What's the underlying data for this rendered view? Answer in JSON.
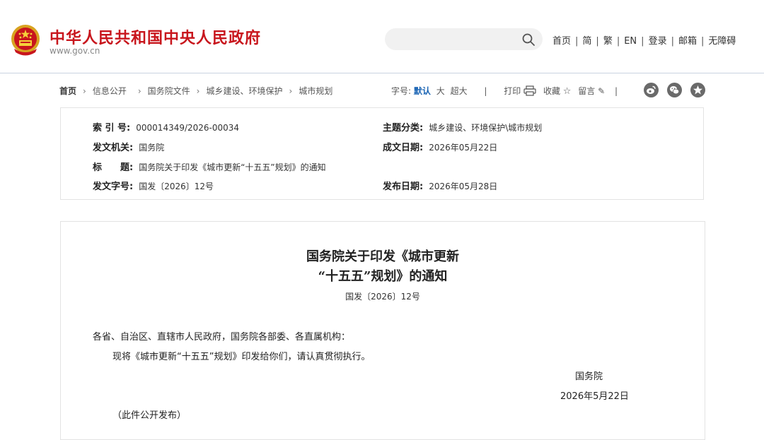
{
  "header": {
    "site_title": "中华人民共和国中央人民政府",
    "domain": "www.gov.cn",
    "search_placeholder": "",
    "nav": [
      "首页",
      "简",
      "繁",
      "EN",
      "登录",
      "邮箱",
      "无障碍"
    ],
    "brand_color": "#c8161d"
  },
  "breadcrumb": [
    "首页",
    "信息公开",
    "国务院文件",
    "城乡建设、环境保护",
    "城市规划"
  ],
  "tools": {
    "font_label": "字号:",
    "font_default": "默认",
    "font_large": "大",
    "font_xlarge": "超大",
    "print": "打印",
    "favorite": "收藏",
    "comment": "留言",
    "share_icons": [
      "weibo-icon",
      "wechat-icon",
      "qzone-icon"
    ]
  },
  "meta": {
    "index_label": "索 引 号:",
    "index_value": "000014349/2026-00034",
    "category_label": "主题分类:",
    "category_value": "城乡建设、环境保护\\城市规划",
    "issuer_label": "发文机关:",
    "issuer_value": "国务院",
    "written_label": "成文日期:",
    "written_value": "2026年05月22日",
    "title_label": "标　　题:",
    "title_value": "国务院关于印发《城市更新“十五五”规划》的通知",
    "docno_label": "发文字号:",
    "docno_value": "国发〔2026〕12号",
    "published_label": "发布日期:",
    "published_value": "2026年05月28日"
  },
  "document": {
    "title_line1": "国务院关于印发《城市更新",
    "title_line2": "“十五五”规划》的通知",
    "doc_number": "国发〔2026〕12号",
    "salutation": "各省、自治区、直辖市人民政府，国务院各部委、各直属机构：",
    "body": "现将《城市更新“十五五”规划》印发给你们，请认真贯彻执行。",
    "signature": "国务院",
    "date": "2026年5月22日",
    "note": "（此件公开发布）"
  }
}
